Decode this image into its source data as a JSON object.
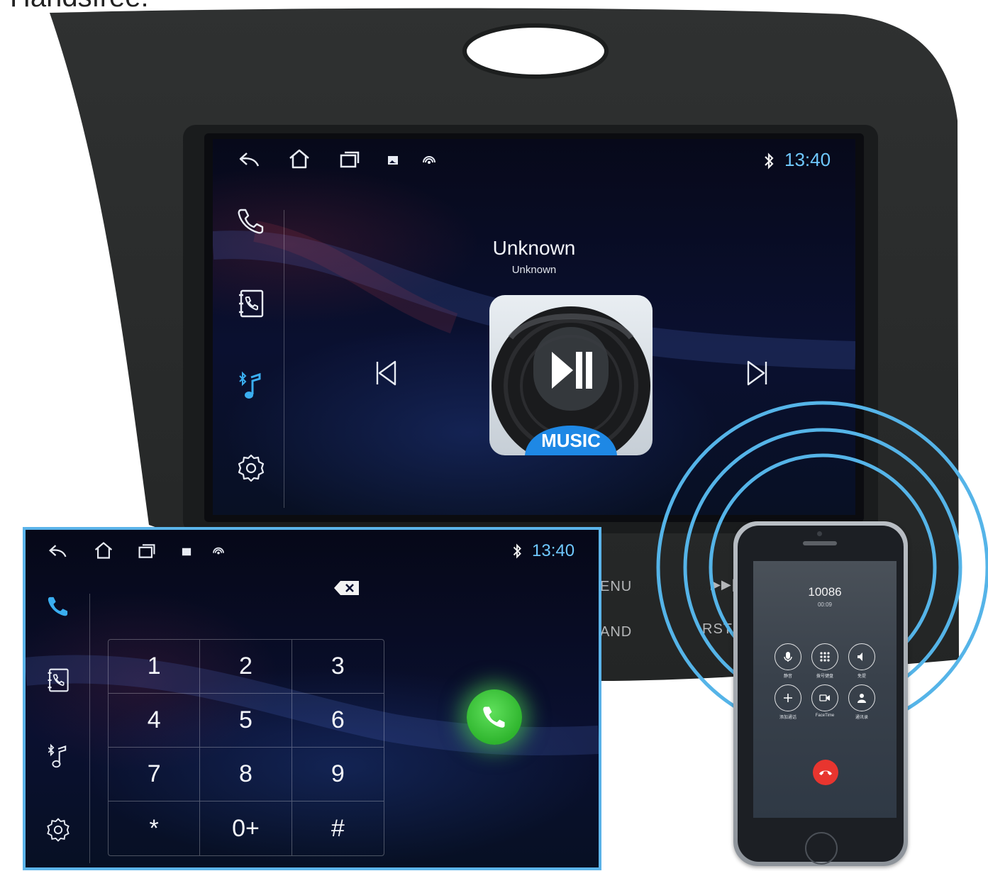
{
  "page": {
    "heading": "Handsfree:"
  },
  "main_screen": {
    "time": "13:40",
    "status_icons": [
      "back-icon",
      "home-icon",
      "recents-icon",
      "gallery-icon",
      "signal-icon",
      "bluetooth-icon"
    ],
    "sidebar": [
      "phone-icon",
      "contacts-icon",
      "bluetooth-music-icon",
      "settings-icon"
    ],
    "sidebar_active": "bluetooth-music-icon",
    "accent": "#6fc8ff",
    "track": {
      "title": "Unknown",
      "artist": "Unknown"
    },
    "album_badge": "MUSIC",
    "controls": [
      "previous-track-icon",
      "play-pause-icon",
      "next-track-icon"
    ]
  },
  "console": {
    "buttons": [
      "ENU",
      "AND",
      "RST"
    ],
    "skip_label": "▶▶|"
  },
  "dialer_screen": {
    "time": "13:40",
    "sidebar_active": "phone-icon",
    "frame_color": "#5bb4ea",
    "keys": [
      "1",
      "2",
      "3",
      "4",
      "5",
      "6",
      "7",
      "8",
      "9",
      "*",
      "0+",
      "#"
    ],
    "call_button_color": "#2fb52e"
  },
  "phone": {
    "number": "10086",
    "duration": "00:09",
    "buttons": [
      {
        "icon": "mute-icon",
        "label": "静音"
      },
      {
        "icon": "keypad-icon",
        "label": "拨号键盘"
      },
      {
        "icon": "speaker-icon",
        "label": "免提"
      },
      {
        "icon": "add-call-icon",
        "label": "添加通话"
      },
      {
        "icon": "facetime-icon",
        "label": "FaceTime"
      },
      {
        "icon": "contacts-icon",
        "label": "通讯录"
      }
    ],
    "end_call_color": "#e8352f"
  }
}
